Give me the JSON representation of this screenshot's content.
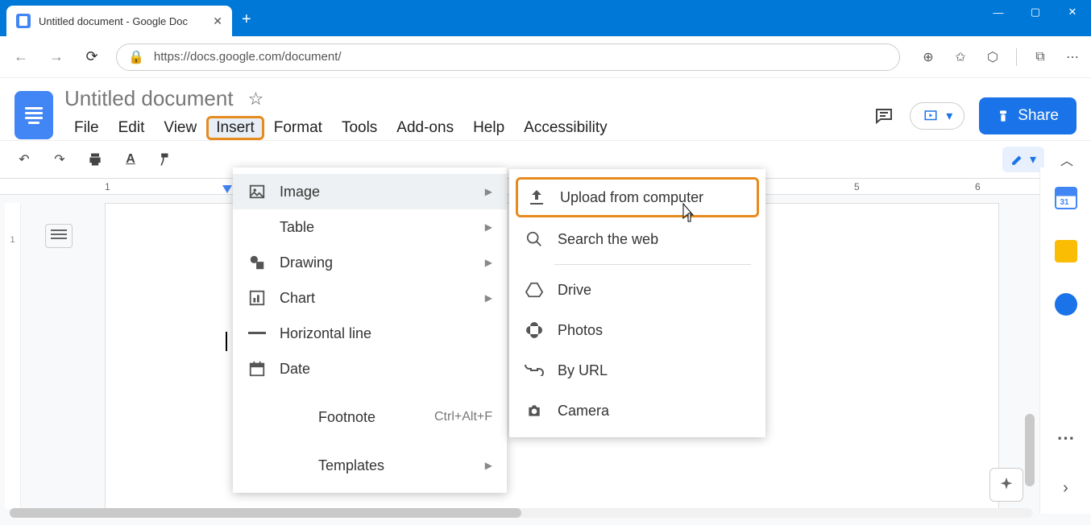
{
  "browser": {
    "tab_title": "Untitled document - Google Doc",
    "url": "https://docs.google.com/document/"
  },
  "docs": {
    "title": "Untitled document",
    "menus": [
      "File",
      "Edit",
      "View",
      "Insert",
      "Format",
      "Tools",
      "Add-ons",
      "Help",
      "Accessibility"
    ],
    "active_menu_index": 3,
    "share_label": "Share"
  },
  "ruler": {
    "visible_numbers": [
      "1",
      "5",
      "6"
    ],
    "left_num": "1"
  },
  "insert_menu": [
    {
      "icon": "image-icon",
      "label": "Image",
      "submenu": true,
      "hover": true
    },
    {
      "icon": "table-icon",
      "label": "Table",
      "submenu": true
    },
    {
      "icon": "drawing-icon",
      "label": "Drawing",
      "submenu": true
    },
    {
      "icon": "chart-icon",
      "label": "Chart",
      "submenu": true
    },
    {
      "icon": "line-icon",
      "label": "Horizontal line"
    },
    {
      "icon": "date-icon",
      "label": "Date"
    },
    {
      "icon": "footnote-icon",
      "label": "Footnote",
      "shortcut": "Ctrl+Alt+F",
      "sep_before": true
    },
    {
      "icon": "templates-icon",
      "label": "Templates",
      "submenu": true,
      "sep_before": true
    }
  ],
  "image_submenu": [
    {
      "icon": "upload-icon",
      "label": "Upload from computer",
      "highlighted": true
    },
    {
      "icon": "search-icon",
      "label": "Search the web"
    },
    {
      "sep": true
    },
    {
      "icon": "drive-icon",
      "label": "Drive"
    },
    {
      "icon": "photos-icon",
      "label": "Photos"
    },
    {
      "icon": "link-icon",
      "label": "By URL"
    },
    {
      "icon": "camera-icon",
      "label": "Camera"
    }
  ]
}
